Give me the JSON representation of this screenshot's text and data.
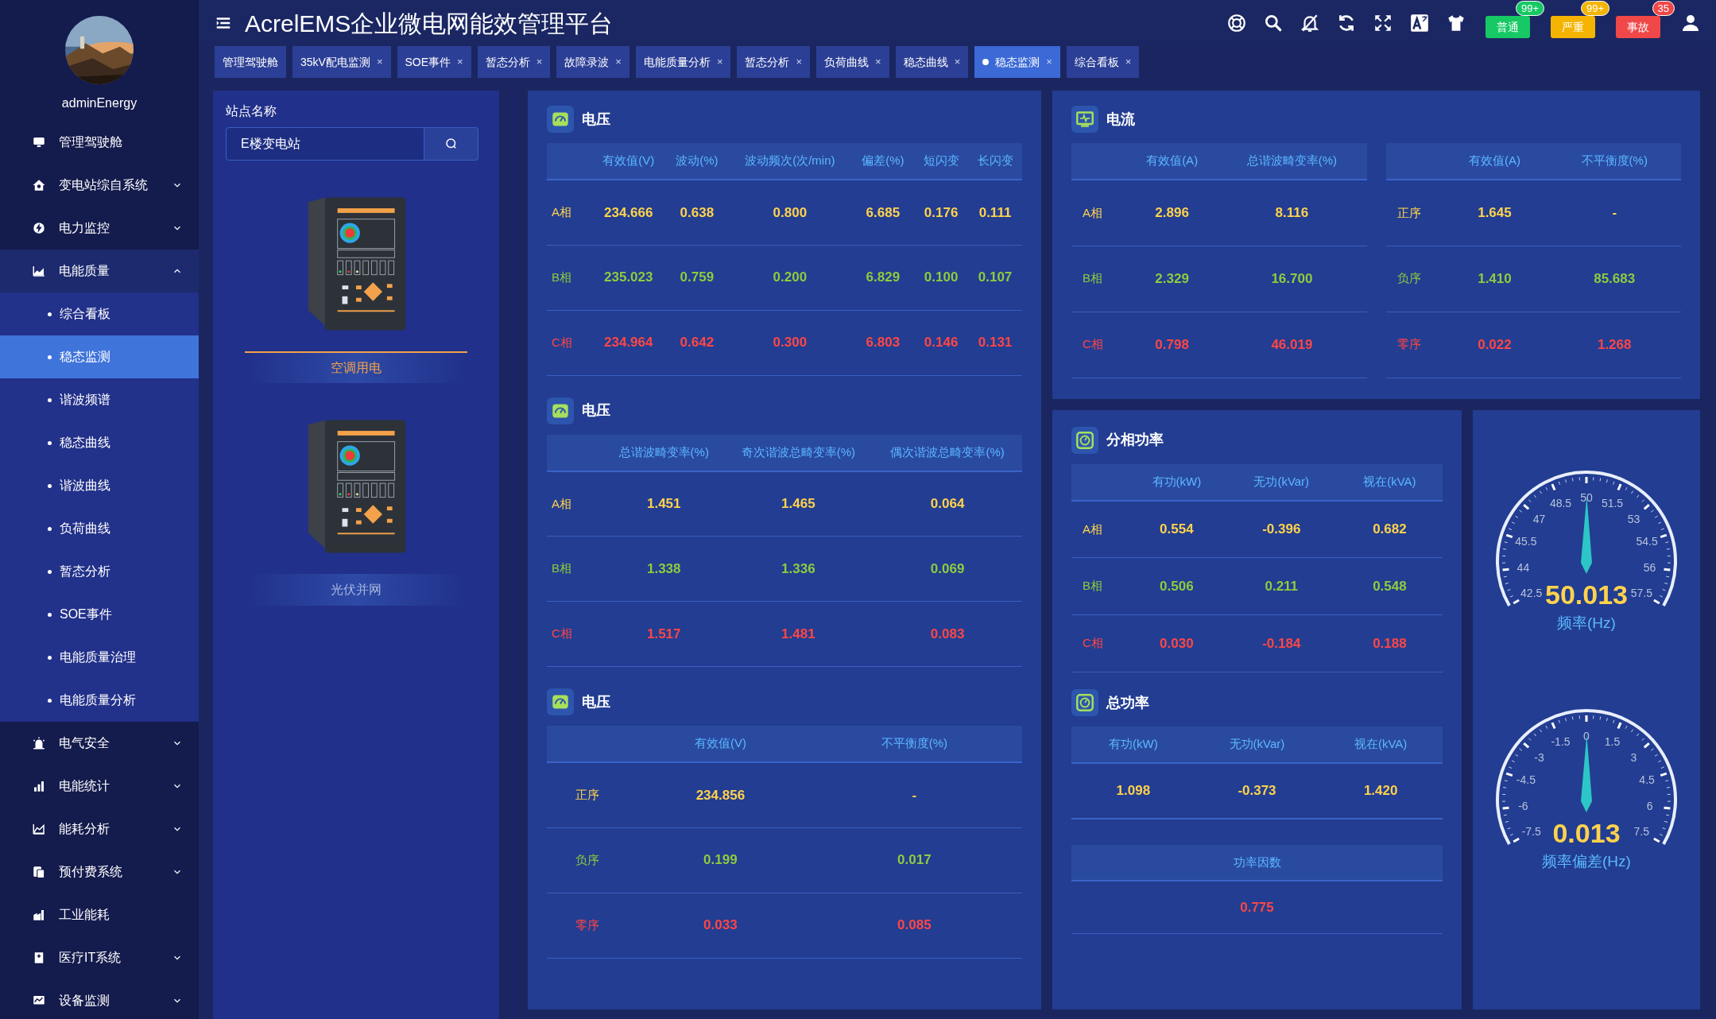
{
  "sidebar": {
    "user": {
      "name": "adminEnergy"
    },
    "items": [
      {
        "label": "管理驾驶舱",
        "kind": "link"
      },
      {
        "label": "变电站综自系统",
        "kind": "group",
        "expanded": false
      },
      {
        "label": "电力监控",
        "kind": "group",
        "expanded": false
      },
      {
        "label": "电能质量",
        "kind": "group",
        "expanded": true,
        "children": [
          {
            "label": "综合看板",
            "selected": false
          },
          {
            "label": "稳态监测",
            "selected": true
          },
          {
            "label": "谐波频谱",
            "selected": false
          },
          {
            "label": "稳态曲线",
            "selected": false
          },
          {
            "label": "谐波曲线",
            "selected": false
          },
          {
            "label": "负荷曲线",
            "selected": false
          },
          {
            "label": "暂态分析",
            "selected": false
          },
          {
            "label": "SOE事件",
            "selected": false
          },
          {
            "label": "电能质量治理",
            "selected": false
          },
          {
            "label": "电能质量分析",
            "selected": false
          }
        ]
      },
      {
        "label": "电气安全",
        "kind": "group",
        "expanded": false
      },
      {
        "label": "电能统计",
        "kind": "group",
        "expanded": false
      },
      {
        "label": "能耗分析",
        "kind": "group",
        "expanded": false
      },
      {
        "label": "预付费系统",
        "kind": "group",
        "expanded": false
      },
      {
        "label": "工业能耗",
        "kind": "link"
      },
      {
        "label": "医疗IT系统",
        "kind": "group",
        "expanded": false
      },
      {
        "label": "设备监测",
        "kind": "group",
        "expanded": false
      }
    ]
  },
  "header": {
    "title": "AcrelEMS企业微电网能效管理平台",
    "alerts": [
      {
        "label": "普通",
        "count": "99+",
        "color": "#17c964"
      },
      {
        "label": "严重",
        "count": "99+",
        "color": "#f5b400"
      },
      {
        "label": "事故",
        "count": "35",
        "color": "#f04848"
      }
    ]
  },
  "tabs": [
    {
      "label": "管理驾驶舱",
      "selected": false
    },
    {
      "label": "35kV配电监测",
      "close": "×",
      "selected": false
    },
    {
      "label": "SOE事件",
      "close": "×",
      "selected": false
    },
    {
      "label": "暂态分析",
      "close": "×",
      "selected": false
    },
    {
      "label": "故障录波",
      "close": "×",
      "selected": false
    },
    {
      "label": "电能质量分析",
      "close": "×",
      "selected": false
    },
    {
      "label": "暂态分析",
      "close": "×",
      "selected": false
    },
    {
      "label": "负荷曲线",
      "close": "×",
      "selected": false
    },
    {
      "label": "稳态曲线",
      "close": "×",
      "selected": false
    },
    {
      "label": "稳态监测",
      "close": "×",
      "selected": true
    },
    {
      "label": "综合看板",
      "close": "×",
      "selected": false
    }
  ],
  "station": {
    "label": "站点名称",
    "value": "E楼变电站",
    "devices": [
      {
        "name": "空调用电",
        "selected": true
      },
      {
        "name": "光伏并网",
        "selected": false
      }
    ]
  },
  "voltage_panel": {
    "sections": [
      {
        "title": "电压",
        "columns": [
          "有效值(V)",
          "波动(%)",
          "波动频次(次/min)",
          "偏差(%)",
          "短闪变",
          "长闪变"
        ],
        "rows": [
          {
            "label": "A相",
            "color": "#ffd24d",
            "values": [
              "234.666",
              "0.638",
              "0.800",
              "6.685",
              "0.176",
              "0.111"
            ]
          },
          {
            "label": "B相",
            "color": "#8fcb3f",
            "values": [
              "235.023",
              "0.759",
              "0.200",
              "6.829",
              "0.100",
              "0.107"
            ]
          },
          {
            "label": "C相",
            "color": "#ff4646",
            "values": [
              "234.964",
              "0.642",
              "0.300",
              "6.803",
              "0.146",
              "0.131"
            ]
          }
        ]
      },
      {
        "title": "电压",
        "columns": [
          "总谐波畸变率(%)",
          "奇次谐波总畸变率(%)",
          "偶次谐波总畸变率(%)"
        ],
        "rows": [
          {
            "label": "A相",
            "color": "#ffd24d",
            "values": [
              "1.451",
              "1.465",
              "0.064"
            ]
          },
          {
            "label": "B相",
            "color": "#8fcb3f",
            "values": [
              "1.338",
              "1.336",
              "0.069"
            ]
          },
          {
            "label": "C相",
            "color": "#ff4646",
            "values": [
              "1.517",
              "1.481",
              "0.083"
            ]
          }
        ]
      },
      {
        "title": "电压",
        "columns": [
          "有效值(V)",
          "不平衡度(%)"
        ],
        "rows": [
          {
            "label": "正序",
            "color": "#ffd24d",
            "values": [
              "234.856",
              "-"
            ]
          },
          {
            "label": "负序",
            "color": "#8fcb3f",
            "values": [
              "0.199",
              "0.017"
            ]
          },
          {
            "label": "零序",
            "color": "#ff4646",
            "values": [
              "0.033",
              "0.085"
            ]
          }
        ]
      }
    ]
  },
  "current_panel": {
    "title": "电流",
    "tables": [
      {
        "columns": [
          "有效值(A)",
          "总谐波畸变率(%)"
        ],
        "rows": [
          {
            "label": "A相",
            "color": "#ffd24d",
            "values": [
              "2.896",
              "8.116"
            ]
          },
          {
            "label": "B相",
            "color": "#8fcb3f",
            "values": [
              "2.329",
              "16.700"
            ]
          },
          {
            "label": "C相",
            "color": "#ff4646",
            "values": [
              "0.798",
              "46.019"
            ]
          }
        ]
      },
      {
        "columns": [
          "有效值(A)",
          "不平衡度(%)"
        ],
        "rows": [
          {
            "label": "正序",
            "color": "#ffd24d",
            "values": [
              "1.645",
              "-"
            ]
          },
          {
            "label": "负序",
            "color": "#8fcb3f",
            "values": [
              "1.410",
              "85.683"
            ]
          },
          {
            "label": "零序",
            "color": "#ff4646",
            "values": [
              "0.022",
              "1.268"
            ]
          }
        ]
      }
    ]
  },
  "power_panel": {
    "phase": {
      "title": "分相功率",
      "columns": [
        "有功(kW)",
        "无功(kVar)",
        "视在(kVA)"
      ],
      "rows": [
        {
          "label": "A相",
          "color": "#ffd24d",
          "values": [
            "0.554",
            "-0.396",
            "0.682"
          ]
        },
        {
          "label": "B相",
          "color": "#8fcb3f",
          "values": [
            "0.506",
            "0.211",
            "0.548"
          ]
        },
        {
          "label": "C相",
          "color": "#ff4646",
          "values": [
            "0.030",
            "-0.184",
            "0.188"
          ]
        }
      ]
    },
    "total": {
      "title": "总功率",
      "columns": [
        "有功(kW)",
        "无功(kVar)",
        "视在(kVA)"
      ],
      "values": [
        "1.098",
        "-0.373",
        "1.420"
      ]
    },
    "factor": {
      "column": "功率因数",
      "value": "0.775"
    }
  },
  "gauges": [
    {
      "value": "50.013",
      "caption": "频率(Hz)",
      "level": 0.501,
      "ticks": [
        "50",
        "48.5",
        "51.5",
        "47",
        "53",
        "45.5",
        "54.5",
        "44",
        "56",
        "42.5",
        "57.5"
      ]
    },
    {
      "value": "0.013",
      "caption": "频率偏差(Hz)",
      "level": 0.501,
      "ticks": [
        "0",
        "-1.5",
        "1.5",
        "-3",
        "3",
        "-4.5",
        "4.5",
        "-6",
        "6",
        "-7.5",
        "7.5"
      ]
    }
  ]
}
